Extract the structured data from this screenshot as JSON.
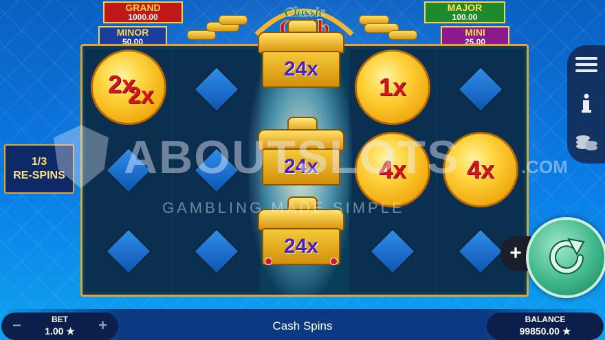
{
  "jackpots": {
    "grand": {
      "label": "GRAND",
      "value": "1000.00"
    },
    "minor": {
      "label": "MINOR",
      "value": "50.00"
    },
    "major": {
      "label": "MAJOR",
      "value": "100.00"
    },
    "mini": {
      "label": "MINI",
      "value": "25.00"
    }
  },
  "logo": {
    "script": "Classic",
    "main": "Cash"
  },
  "respins": {
    "count": "1/3",
    "label": "RE-SPINS"
  },
  "coins": {
    "c1": "2x",
    "c1_second": "2x",
    "c2": "1x",
    "c3": "4x",
    "c4": "4x"
  },
  "pots": [
    "24x",
    "24x",
    "24x"
  ],
  "watermark": {
    "brand": "ABOUTSLOTS",
    "tld": ".COM",
    "tagline": "GAMBLING MADE SIMPLE"
  },
  "footer": {
    "bet_label": "BET",
    "bet_value": "1.00 ★",
    "message": "Cash Spins",
    "balance_label": "BALANCE",
    "balance_value": "99850.00 ★",
    "minus": "−",
    "plus": "+"
  },
  "side_menu": {
    "menu_icon": "menu-icon",
    "info_icon": "info-icon",
    "chips_icon": "chips-icon"
  },
  "colors": {
    "accent_gold": "#e6a52a",
    "multiplier_red": "#d4161c",
    "pot_multiplier": "#4a22b8",
    "spin_green": "#3fb68a"
  }
}
